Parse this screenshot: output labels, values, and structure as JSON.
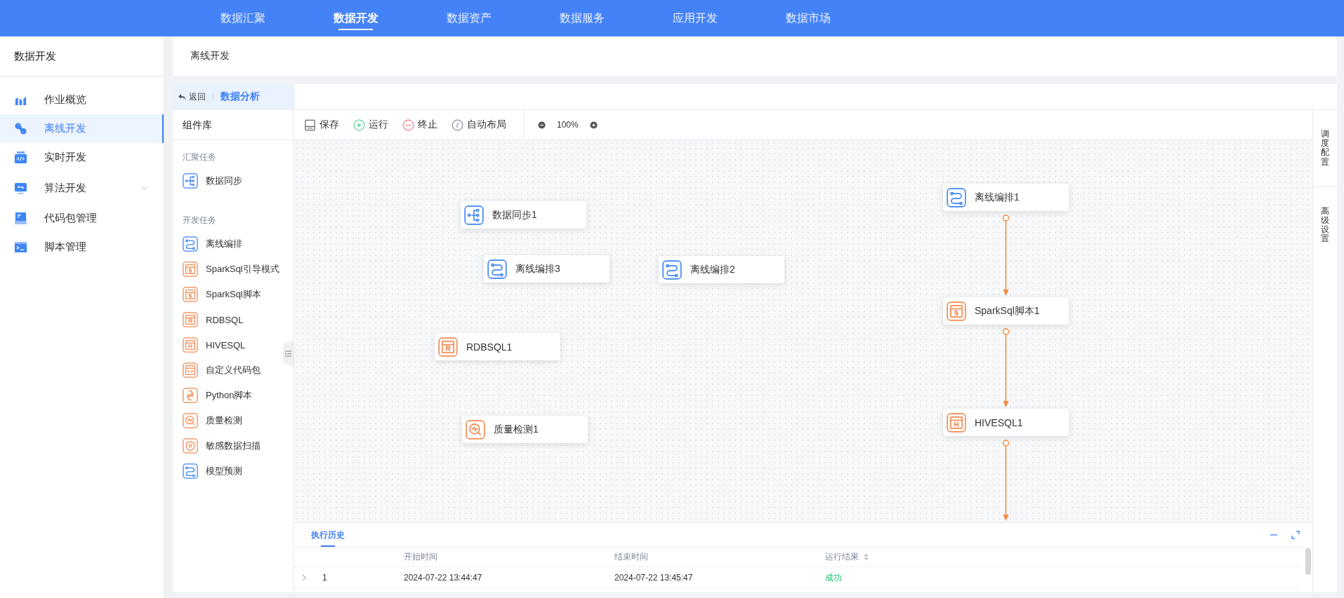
{
  "top_nav": {
    "tabs": [
      {
        "label": "数据汇聚",
        "selected": false
      },
      {
        "label": "数据开发",
        "selected": true
      },
      {
        "label": "数据资产",
        "selected": false
      },
      {
        "label": "数据服务",
        "selected": false
      },
      {
        "label": "应用开发",
        "selected": false
      },
      {
        "label": "数据市场",
        "selected": false
      }
    ]
  },
  "sidebar": {
    "title": "数据开发",
    "items": [
      {
        "label": "作业概览",
        "selected": false
      },
      {
        "label": "离线开发",
        "selected": true
      },
      {
        "label": "实时开发",
        "selected": false
      },
      {
        "label": "算法开发",
        "selected": false,
        "expanded": false
      },
      {
        "label": "代码包管理",
        "selected": false
      },
      {
        "label": "脚本管理",
        "selected": false
      }
    ]
  },
  "breadcrumb": "离线开发",
  "panel_header": {
    "back": "返回",
    "title": "数据分析"
  },
  "component_library": {
    "title": "组件库",
    "groups": [
      {
        "label": "汇聚任务",
        "items": [
          {
            "label": "数据同步",
            "kind": "sync"
          }
        ]
      },
      {
        "label": "开发任务",
        "items": [
          {
            "label": "离线编排",
            "kind": "orchestrate"
          },
          {
            "label": "SparkSql引导模式",
            "kind": "sparksql"
          },
          {
            "label": "SparkSql脚本",
            "kind": "sparksql"
          },
          {
            "label": "RDBSQL",
            "kind": "rdbsql"
          },
          {
            "label": "HIVESQL",
            "kind": "hivesql"
          },
          {
            "label": "自定义代码包",
            "kind": "custom"
          },
          {
            "label": "Python脚本",
            "kind": "python"
          },
          {
            "label": "质量检测",
            "kind": "quality"
          },
          {
            "label": "敏感数据扫描",
            "kind": "sensitive"
          },
          {
            "label": "模型预测",
            "kind": "model"
          }
        ]
      }
    ]
  },
  "toolbar": {
    "buttons": [
      {
        "label": "保存",
        "kind": "save"
      },
      {
        "label": "运行",
        "kind": "run"
      },
      {
        "label": "终止",
        "kind": "stop"
      },
      {
        "label": "自动布局",
        "kind": "layout"
      }
    ],
    "zoom": "100%"
  },
  "canvas": {
    "nodes": [
      {
        "label": "数据同步1",
        "kind": "sync",
        "linked_down": false
      },
      {
        "label": "离线编排3",
        "kind": "orchestrate",
        "linked_down": false
      },
      {
        "label": "离线编排2",
        "kind": "orchestrate",
        "linked_down": false
      },
      {
        "label": "RDBSQL1",
        "kind": "rdbsql",
        "linked_down": false
      },
      {
        "label": "质量检测1",
        "kind": "quality",
        "linked_down": false
      },
      {
        "label": "离线编排1",
        "kind": "orchestrate",
        "linked_down": true
      },
      {
        "label": "SparkSql脚本1",
        "kind": "sparksql",
        "linked_down": true
      },
      {
        "label": "HIVESQL1",
        "kind": "hivesql",
        "linked_down": true
      }
    ]
  },
  "right_panel": {
    "tabs": [
      "调度配置",
      "高级设置"
    ]
  },
  "history": {
    "tabs": [
      {
        "label": "执行历史",
        "selected": true
      }
    ],
    "columns": [
      {
        "label": "开始时间",
        "sortable": false
      },
      {
        "label": "结束时间",
        "sortable": false
      },
      {
        "label": "运行结果",
        "sortable": true
      }
    ],
    "rows": [
      {
        "index": "1",
        "start": "2024-07-22 13:44:47",
        "end": "2024-07-22 13:45:47",
        "result": "成功",
        "color": "#19be6b",
        "expanded": false
      }
    ]
  }
}
